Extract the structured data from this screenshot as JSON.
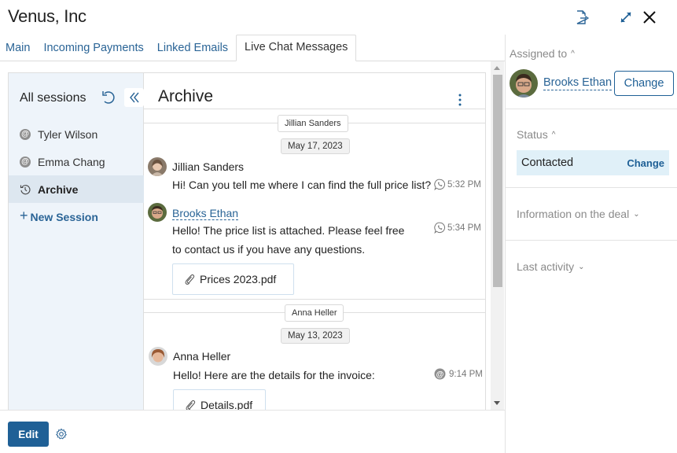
{
  "header": {
    "title": "Venus, Inc",
    "icons": [
      "export-document-icon",
      "expand-icon",
      "close-icon"
    ]
  },
  "tabs": [
    {
      "label": "Main",
      "active": false
    },
    {
      "label": "Incoming Payments",
      "active": false
    },
    {
      "label": "Linked Emails",
      "active": false
    },
    {
      "label": "Live Chat Messages",
      "active": true
    }
  ],
  "sessions": {
    "title": "All sessions",
    "items": [
      {
        "label": "Tyler Wilson",
        "icon": "at-icon",
        "active": false
      },
      {
        "label": "Emma Chang",
        "icon": "at-icon",
        "active": false
      },
      {
        "label": "Archive",
        "icon": "history-icon",
        "active": true
      }
    ],
    "new_session_label": "New Session"
  },
  "conversation": {
    "title": "Archive",
    "groups": [
      {
        "contact": "Jillian Sanders",
        "date": "May 17, 2023",
        "messages": [
          {
            "sender": "Jillian Sanders",
            "sender_is_link": false,
            "lines": [
              "Hi! Can you tell me where I can find the full price list?"
            ],
            "channel": "whatsapp",
            "time": "5:32 PM"
          },
          {
            "sender": "Brooks Ethan",
            "sender_is_link": true,
            "lines": [
              "Hello! The price list is attached. Please feel free",
              "to contact us  if you have any questions."
            ],
            "channel": "whatsapp",
            "time": "5:34 PM",
            "attachment": "Prices 2023.pdf"
          }
        ]
      },
      {
        "contact": "Anna Heller",
        "date": "May 13, 2023",
        "messages": [
          {
            "sender": "Anna Heller",
            "sender_is_link": false,
            "lines": [
              "Hello! Here are the details for the invoice:"
            ],
            "channel": "email",
            "time": "9:14 PM",
            "attachment": "Details.pdf"
          }
        ]
      }
    ]
  },
  "footer": {
    "edit_label": "Edit"
  },
  "right_panel": {
    "assigned_label": "Assigned to",
    "assignee": "Brooks Ethan",
    "change_label": "Change",
    "status_label": "Status",
    "status_value": "Contacted",
    "status_change_label": "Change",
    "deal_info_label": "Information on the deal",
    "last_activity_label": "Last activity"
  },
  "colors": {
    "accent": "#1f6096",
    "link": "#2a6496",
    "status_bg": "#e0f0f8",
    "sessions_bg": "#eef4fa"
  }
}
